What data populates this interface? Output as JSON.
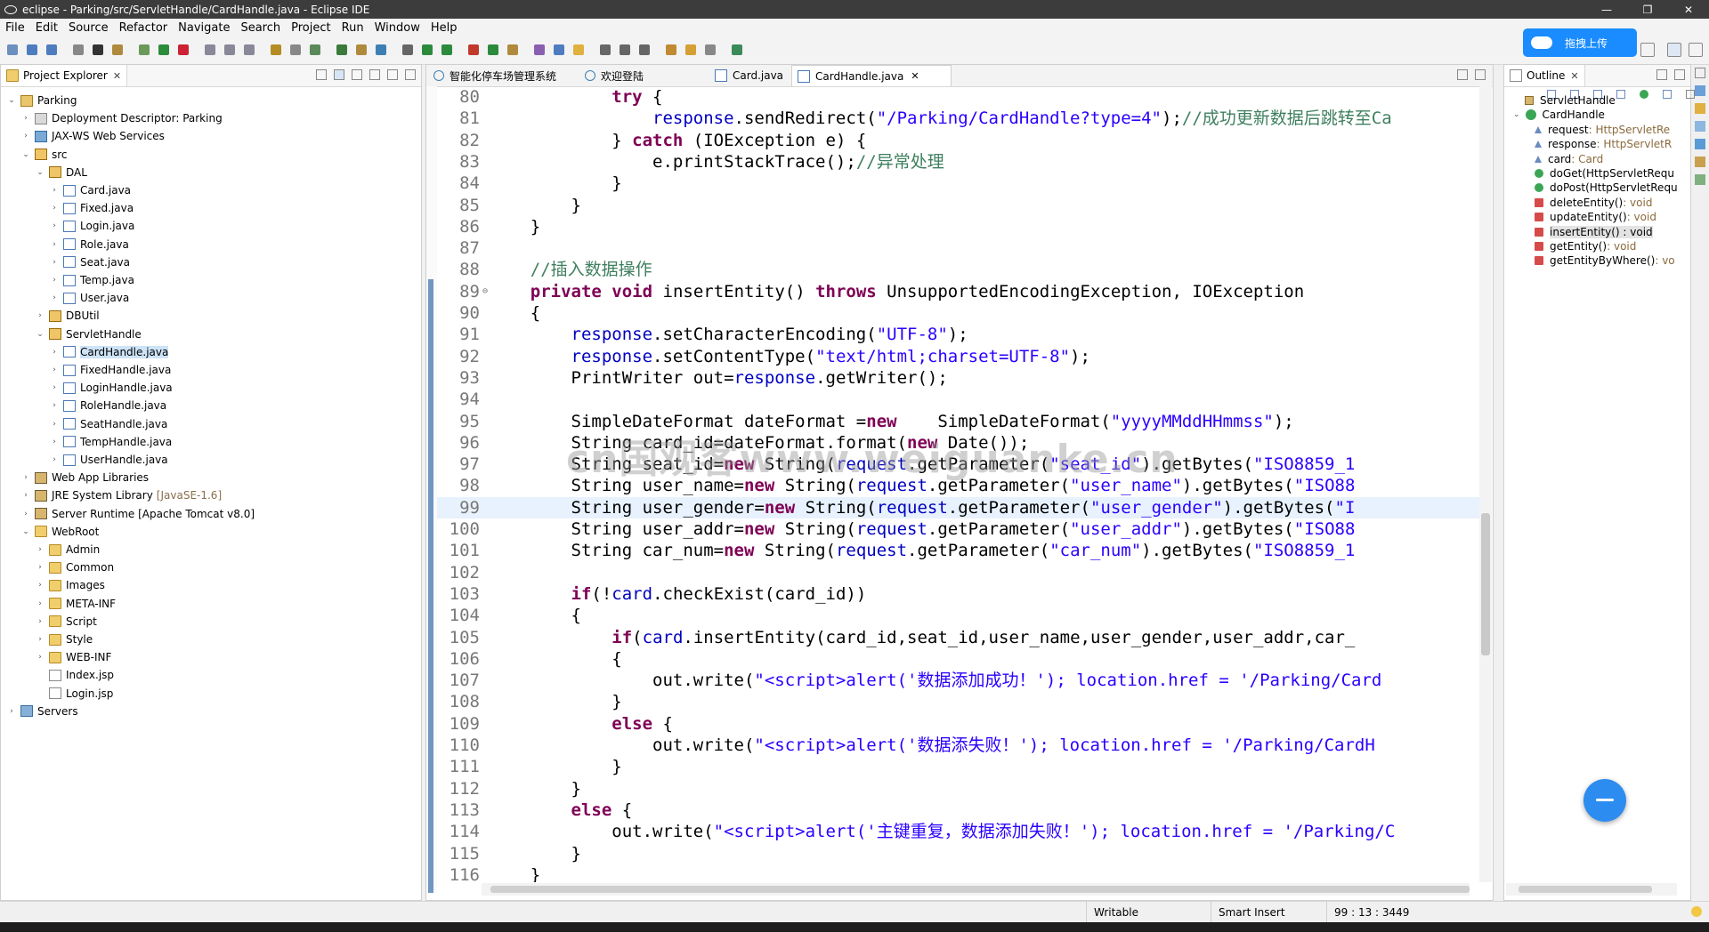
{
  "window": {
    "title": "eclipse - Parking/src/ServletHandle/CardHandle.java - Eclipse IDE",
    "controls": [
      "—",
      "❐",
      "✕"
    ]
  },
  "menu": [
    "File",
    "Edit",
    "Source",
    "Refactor",
    "Navigate",
    "Search",
    "Project",
    "Run",
    "Window",
    "Help"
  ],
  "upload_button": {
    "label": "拖拽上传"
  },
  "project_explorer": {
    "title": "Project Explorer",
    "items": [
      {
        "label": "Parking",
        "icon": "project-icon",
        "twisty": "⌄"
      },
      {
        "label": "Deployment Descriptor: Parking",
        "icon": "descriptor-icon",
        "twisty": "›"
      },
      {
        "label": "JAX-WS Web Services",
        "icon": "web-services-icon",
        "twisty": "›"
      },
      {
        "label": "src",
        "icon": "source-folder-icon",
        "twisty": "⌄"
      },
      {
        "label": "DAL",
        "icon": "package-icon",
        "twisty": "⌄"
      },
      {
        "label": "Card.java",
        "icon": "java-file-icon",
        "twisty": "›"
      },
      {
        "label": "Fixed.java",
        "icon": "java-file-icon",
        "twisty": "›"
      },
      {
        "label": "Login.java",
        "icon": "java-file-icon",
        "twisty": "›"
      },
      {
        "label": "Role.java",
        "icon": "java-file-icon",
        "twisty": "›"
      },
      {
        "label": "Seat.java",
        "icon": "java-file-icon",
        "twisty": "›"
      },
      {
        "label": "Temp.java",
        "icon": "java-file-icon",
        "twisty": "›"
      },
      {
        "label": "User.java",
        "icon": "java-file-icon",
        "twisty": "›"
      },
      {
        "label": "DBUtil",
        "icon": "package-icon",
        "twisty": "›"
      },
      {
        "label": "ServletHandle",
        "icon": "package-icon",
        "twisty": "⌄"
      },
      {
        "label": "CardHandle.java",
        "icon": "java-file-icon",
        "twisty": "›"
      },
      {
        "label": "FixedHandle.java",
        "icon": "java-file-icon",
        "twisty": "›"
      },
      {
        "label": "LoginHandle.java",
        "icon": "java-file-icon",
        "twisty": "›"
      },
      {
        "label": "RoleHandle.java",
        "icon": "java-file-icon",
        "twisty": "›"
      },
      {
        "label": "SeatHandle.java",
        "icon": "java-file-icon",
        "twisty": "›"
      },
      {
        "label": "TempHandle.java",
        "icon": "java-file-icon",
        "twisty": "›"
      },
      {
        "label": "UserHandle.java",
        "icon": "java-file-icon",
        "twisty": "›"
      },
      {
        "label": "Web App Libraries",
        "icon": "library-icon",
        "twisty": "›"
      },
      {
        "label": "JRE System Library",
        "decor": "[JavaSE-1.6]",
        "icon": "library-icon",
        "twisty": "›"
      },
      {
        "label": "Server Runtime [Apache Tomcat v8.0]",
        "icon": "library-icon",
        "twisty": "›"
      },
      {
        "label": "WebRoot",
        "icon": "web-folder-icon",
        "twisty": "⌄"
      },
      {
        "label": "Admin",
        "icon": "folder-icon",
        "twisty": "›"
      },
      {
        "label": "Common",
        "icon": "folder-icon",
        "twisty": "›"
      },
      {
        "label": "Images",
        "icon": "folder-icon",
        "twisty": "›"
      },
      {
        "label": "META-INF",
        "icon": "folder-icon",
        "twisty": "›"
      },
      {
        "label": "Script",
        "icon": "folder-icon",
        "twisty": "›"
      },
      {
        "label": "Style",
        "icon": "folder-icon",
        "twisty": "›"
      },
      {
        "label": "WEB-INF",
        "icon": "folder-icon",
        "twisty": "›"
      },
      {
        "label": "Index.jsp",
        "icon": "jsp-file-icon",
        "twisty": ""
      },
      {
        "label": "Login.jsp",
        "icon": "jsp-file-icon",
        "twisty": ""
      },
      {
        "label": "Servers",
        "icon": "servers-folder-icon",
        "twisty": "›"
      }
    ],
    "selected_index": 14
  },
  "editor": {
    "tabs": [
      {
        "label": "智能化停车场管理系统",
        "icon": "globe-icon",
        "active": false
      },
      {
        "label": "欢迎登陆",
        "icon": "globe-icon",
        "active": false
      },
      {
        "label": "Card.java",
        "icon": "java-file-icon",
        "active": false
      },
      {
        "label": "CardHandle.java",
        "icon": "java-file-icon",
        "active": true
      }
    ],
    "current_line": 99,
    "lines": [
      {
        "n": "80",
        "t": [
          [
            "            ",
            ""
          ],
          [
            "try",
            "k"
          ],
          [
            " {",
            ""
          ]
        ]
      },
      {
        "n": "81",
        "t": [
          [
            "                ",
            ""
          ],
          [
            "response",
            "f"
          ],
          [
            ".sendRedirect(",
            ""
          ],
          [
            "\"/Parking/CardHandle?type=4\"",
            "s"
          ],
          [
            ");",
            ""
          ],
          [
            "//成功更新数据后跳转至Ca",
            "c"
          ]
        ]
      },
      {
        "n": "82",
        "t": [
          [
            "            } ",
            ""
          ],
          [
            "catch",
            "k"
          ],
          [
            " (IOException e) {",
            ""
          ]
        ]
      },
      {
        "n": "83",
        "t": [
          [
            "                e.printStackTrace();",
            ""
          ],
          [
            "//异常处理",
            "c"
          ]
        ]
      },
      {
        "n": "84",
        "t": [
          [
            "            }",
            ""
          ]
        ]
      },
      {
        "n": "85",
        "t": [
          [
            "        }",
            ""
          ]
        ]
      },
      {
        "n": "86",
        "t": [
          [
            "    }",
            ""
          ]
        ]
      },
      {
        "n": "87",
        "t": [
          [
            "",
            ""
          ]
        ]
      },
      {
        "n": "88",
        "t": [
          [
            "    ",
            ""
          ],
          [
            "//插入数据操作",
            "c"
          ]
        ]
      },
      {
        "n": "89",
        "fold": "⊖",
        "t": [
          [
            "    ",
            ""
          ],
          [
            "private",
            "k"
          ],
          [
            " ",
            ""
          ],
          [
            "void",
            "k"
          ],
          [
            " insertEntity() ",
            ""
          ],
          [
            "throws",
            "k"
          ],
          [
            " UnsupportedEncodingException, IOException",
            ""
          ]
        ]
      },
      {
        "n": "90",
        "t": [
          [
            "    {",
            ""
          ]
        ]
      },
      {
        "n": "91",
        "t": [
          [
            "        ",
            ""
          ],
          [
            "response",
            "f"
          ],
          [
            ".setCharacterEncoding(",
            ""
          ],
          [
            "\"UTF-8\"",
            "s"
          ],
          [
            ");",
            ""
          ]
        ]
      },
      {
        "n": "92",
        "t": [
          [
            "        ",
            ""
          ],
          [
            "response",
            "f"
          ],
          [
            ".setContentType(",
            ""
          ],
          [
            "\"text/html;charset=UTF-8\"",
            "s"
          ],
          [
            ");",
            ""
          ]
        ]
      },
      {
        "n": "93",
        "t": [
          [
            "        PrintWriter out=",
            ""
          ],
          [
            "response",
            "f"
          ],
          [
            ".getWriter();",
            ""
          ]
        ]
      },
      {
        "n": "94",
        "t": [
          [
            "",
            ""
          ]
        ]
      },
      {
        "n": "95",
        "t": [
          [
            "        SimpleDateFormat dateFormat =",
            ""
          ],
          [
            "new",
            "k"
          ],
          [
            "    SimpleDateFormat(",
            ""
          ],
          [
            "\"yyyyMMddHHmmss\"",
            "s"
          ],
          [
            ");",
            ""
          ]
        ]
      },
      {
        "n": "96",
        "t": [
          [
            "        String card_id=dateFormat.format(",
            ""
          ],
          [
            "new",
            "k"
          ],
          [
            " Date());",
            ""
          ]
        ]
      },
      {
        "n": "97",
        "t": [
          [
            "        String seat_id=",
            ""
          ],
          [
            "new",
            "k"
          ],
          [
            " String(",
            ""
          ],
          [
            "request",
            "f"
          ],
          [
            ".getParameter(",
            ""
          ],
          [
            "\"seat_id\"",
            "s"
          ],
          [
            ").getBytes(",
            ""
          ],
          [
            "\"ISO8859_1",
            "s"
          ]
        ]
      },
      {
        "n": "98",
        "t": [
          [
            "        String user_name=",
            ""
          ],
          [
            "new",
            "k"
          ],
          [
            " String(",
            ""
          ],
          [
            "request",
            "f"
          ],
          [
            ".getParameter(",
            ""
          ],
          [
            "\"user_name\"",
            "s"
          ],
          [
            ").getBytes(",
            ""
          ],
          [
            "\"ISO88",
            "s"
          ]
        ]
      },
      {
        "n": "99",
        "t": [
          [
            "        String user_gender=",
            ""
          ],
          [
            "new",
            "k"
          ],
          [
            " String(",
            ""
          ],
          [
            "request",
            "f"
          ],
          [
            ".getParameter(",
            ""
          ],
          [
            "\"user_gender\"",
            "s"
          ],
          [
            ").getBytes(",
            ""
          ],
          [
            "\"I",
            "s"
          ]
        ]
      },
      {
        "n": "100",
        "t": [
          [
            "        String user_addr=",
            ""
          ],
          [
            "new",
            "k"
          ],
          [
            " String(",
            ""
          ],
          [
            "request",
            "f"
          ],
          [
            ".getParameter(",
            ""
          ],
          [
            "\"user_addr\"",
            "s"
          ],
          [
            ").getBytes(",
            ""
          ],
          [
            "\"ISO88",
            "s"
          ]
        ]
      },
      {
        "n": "101",
        "t": [
          [
            "        String car_num=",
            ""
          ],
          [
            "new",
            "k"
          ],
          [
            " String(",
            ""
          ],
          [
            "request",
            "f"
          ],
          [
            ".getParameter(",
            ""
          ],
          [
            "\"car_num\"",
            "s"
          ],
          [
            ").getBytes(",
            ""
          ],
          [
            "\"ISO8859_1",
            "s"
          ]
        ]
      },
      {
        "n": "102",
        "t": [
          [
            "",
            ""
          ]
        ]
      },
      {
        "n": "103",
        "t": [
          [
            "        ",
            ""
          ],
          [
            "if",
            "k"
          ],
          [
            "(!",
            ""
          ],
          [
            "card",
            "f"
          ],
          [
            ".checkExist(card_id))",
            ""
          ]
        ]
      },
      {
        "n": "104",
        "t": [
          [
            "        {",
            ""
          ]
        ]
      },
      {
        "n": "105",
        "t": [
          [
            "            ",
            ""
          ],
          [
            "if",
            "k"
          ],
          [
            "(",
            ""
          ],
          [
            "card",
            "f"
          ],
          [
            ".insertEntity(card_id,seat_id,user_name,user_gender,user_addr,car_",
            ""
          ]
        ]
      },
      {
        "n": "106",
        "t": [
          [
            "            {",
            ""
          ]
        ]
      },
      {
        "n": "107",
        "t": [
          [
            "                out.write(",
            ""
          ],
          [
            "\"<script>alert('数据添加成功！'); location.href = '/Parking/Card",
            "s"
          ]
        ]
      },
      {
        "n": "108",
        "t": [
          [
            "            }",
            ""
          ]
        ]
      },
      {
        "n": "109",
        "t": [
          [
            "            ",
            ""
          ],
          [
            "else",
            "k"
          ],
          [
            " {",
            ""
          ]
        ]
      },
      {
        "n": "110",
        "t": [
          [
            "                out.write(",
            ""
          ],
          [
            "\"<script>alert('数据添失败！'); location.href = '/Parking/CardH",
            "s"
          ]
        ]
      },
      {
        "n": "111",
        "t": [
          [
            "            }",
            ""
          ]
        ]
      },
      {
        "n": "112",
        "t": [
          [
            "        }",
            ""
          ]
        ]
      },
      {
        "n": "113",
        "t": [
          [
            "        ",
            ""
          ],
          [
            "else",
            "k"
          ],
          [
            " {",
            ""
          ]
        ]
      },
      {
        "n": "114",
        "t": [
          [
            "            out.write(",
            ""
          ],
          [
            "\"<script>alert('主键重复，数据添加失败！'); location.href = '/Parking/C",
            "s"
          ]
        ]
      },
      {
        "n": "115",
        "t": [
          [
            "        }",
            ""
          ]
        ]
      },
      {
        "n": "116",
        "t": [
          [
            "    }",
            ""
          ]
        ]
      }
    ]
  },
  "watermark": "cn国观客www.weiguanke.cn",
  "outline": {
    "title": "Outline",
    "items": [
      {
        "label": "ServletHandle",
        "type": "",
        "icon": "package-icon",
        "depth": 0,
        "twisty": ""
      },
      {
        "label": "CardHandle",
        "type": "",
        "icon": "class-icon",
        "depth": 0,
        "twisty": "⌄"
      },
      {
        "label": "request",
        "type": " : HttpServletRe",
        "icon": "field-icon",
        "depth": 1,
        "twisty": ""
      },
      {
        "label": "response",
        "type": " : HttpServletR",
        "icon": "field-icon",
        "depth": 1,
        "twisty": ""
      },
      {
        "label": "card",
        "type": " : Card",
        "icon": "field-icon",
        "depth": 1,
        "twisty": ""
      },
      {
        "label": "doGet(HttpServletRequ",
        "type": "",
        "icon": "public-method-icon",
        "depth": 1,
        "twisty": ""
      },
      {
        "label": "doPost(HttpServletRequ",
        "type": "",
        "icon": "public-method-icon",
        "depth": 1,
        "twisty": ""
      },
      {
        "label": "deleteEntity()",
        "type": " : void",
        "icon": "private-method-icon",
        "depth": 1,
        "twisty": ""
      },
      {
        "label": "updateEntity()",
        "type": " : void",
        "icon": "private-method-icon",
        "depth": 1,
        "twisty": ""
      },
      {
        "label": "insertEntity() : void",
        "type": "",
        "icon": "private-method-icon",
        "depth": 1,
        "twisty": ""
      },
      {
        "label": "getEntity()",
        "type": " : void",
        "icon": "private-method-icon",
        "depth": 1,
        "twisty": ""
      },
      {
        "label": "getEntityByWhere()",
        "type": " : vo",
        "icon": "private-method-icon",
        "depth": 1,
        "twisty": ""
      }
    ],
    "selected_index": 9
  },
  "status": {
    "writable": "Writable",
    "insert_mode": "Smart Insert",
    "position": "99 : 13 : 3449"
  }
}
